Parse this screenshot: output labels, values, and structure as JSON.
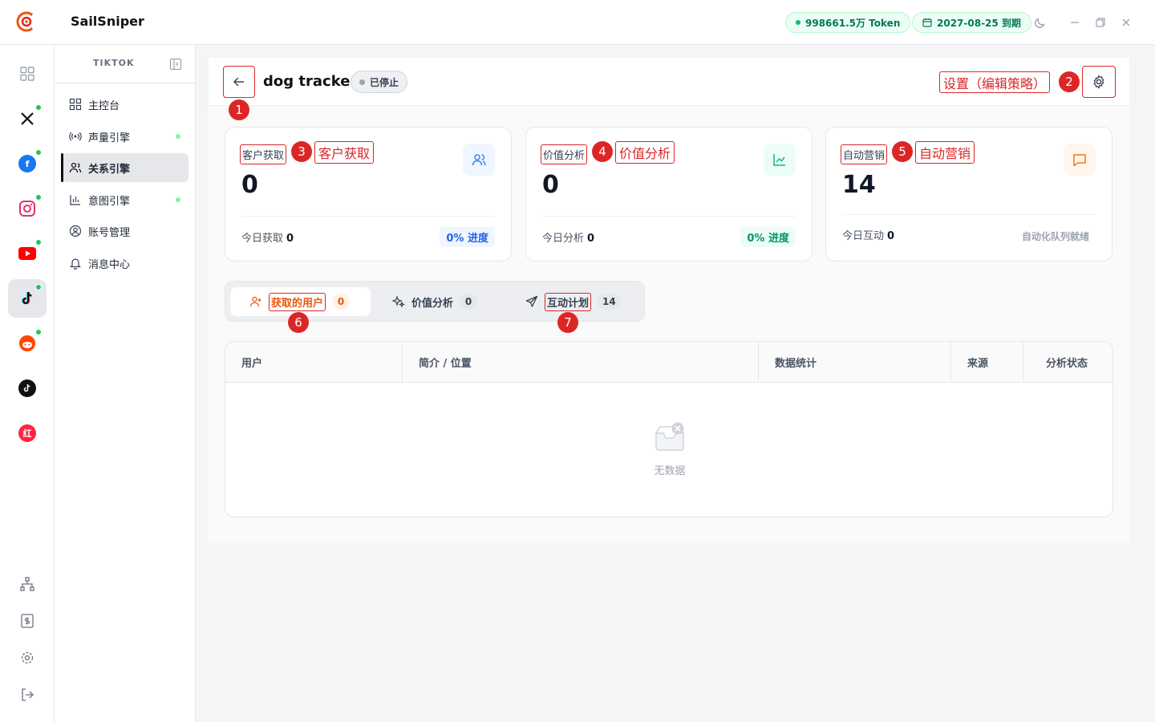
{
  "app": {
    "name": "SailSniper",
    "token_balance": "998661.5万 Token",
    "expiry": "2027-08-25 到期"
  },
  "subsidebar": {
    "title": "TIKTOK",
    "items": [
      {
        "label": "主控台"
      },
      {
        "label": "声量引擎"
      },
      {
        "label": "关系引擎"
      },
      {
        "label": "意图引擎"
      },
      {
        "label": "账号管理"
      },
      {
        "label": "消息中心"
      }
    ]
  },
  "rail": {
    "xiaohongshu_glyph": "红"
  },
  "task": {
    "title": "dog tracker",
    "status": "已停止"
  },
  "annotations": {
    "n1": "1",
    "n2": "2",
    "n3": "3",
    "n4": "4",
    "n5": "5",
    "n6": "6",
    "n7": "7",
    "settings_label": "设置（编辑策略）",
    "acquire_label": "客户获取",
    "value_label": "价值分析",
    "marketing_label": "自动营销"
  },
  "cards": [
    {
      "label": "客户获取",
      "value": "0",
      "foot_label": "今日获取",
      "foot_value": "0",
      "foot_right": "0% 进度",
      "accent": "#3b82f6"
    },
    {
      "label": "价值分析",
      "value": "0",
      "foot_label": "今日分析",
      "foot_value": "0",
      "foot_right": "0% 进度",
      "accent": "#10b981"
    },
    {
      "label": "自动营销",
      "value": "14",
      "foot_label": "今日互动",
      "foot_value": "0",
      "foot_right": "自动化队列就绪",
      "accent": "#f97316"
    }
  ],
  "tabs": [
    {
      "label": "获取的用户",
      "count": "0"
    },
    {
      "label": "价值分析",
      "count": "0"
    },
    {
      "label": "互动计划",
      "count": "14"
    }
  ],
  "table": {
    "columns": [
      "用户",
      "简介 / 位置",
      "数据统计",
      "来源",
      "分析状态"
    ],
    "empty_text": "无数据"
  }
}
